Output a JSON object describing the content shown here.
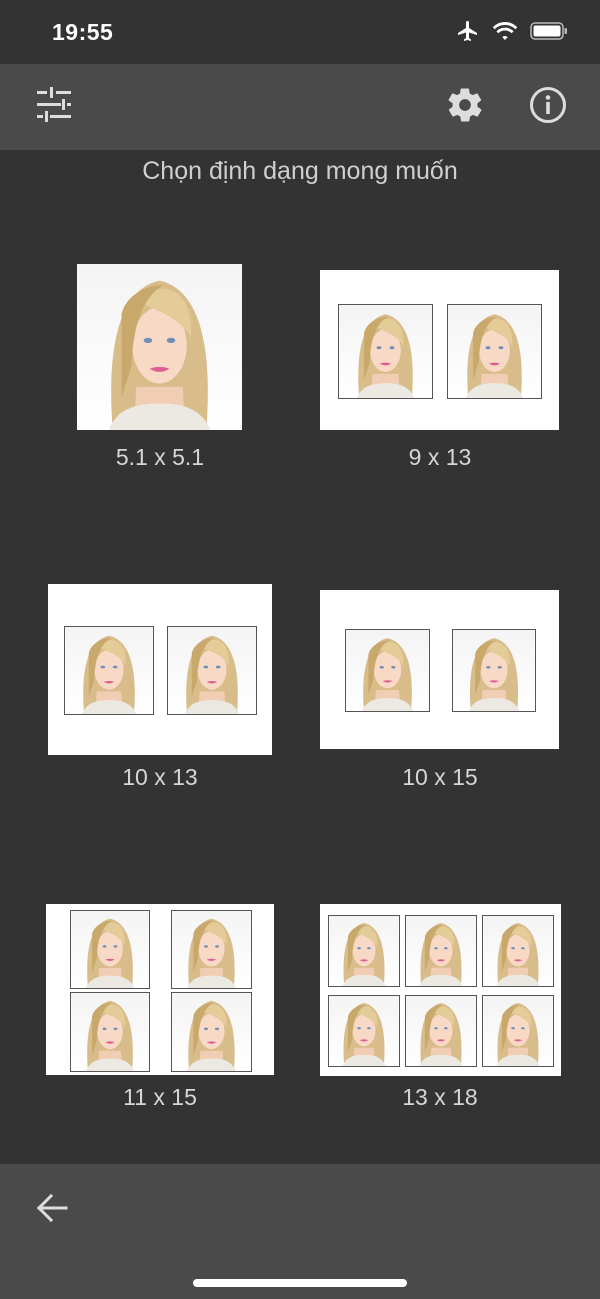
{
  "status_bar": {
    "time": "19:55"
  },
  "toolbar": {
    "icons": [
      "sliders-icon",
      "gear-icon",
      "info-icon"
    ]
  },
  "page": {
    "title": "Chọn định dạng mong muốn"
  },
  "formats": [
    {
      "label": "5.1 x 5.1"
    },
    {
      "label": "9 x 13"
    },
    {
      "label": "10 x 13"
    },
    {
      "label": "10 x 15"
    },
    {
      "label": "11 x 15"
    },
    {
      "label": "13 x 18"
    }
  ],
  "bottom_bar": {
    "icons": [
      "back-arrow-icon"
    ]
  },
  "colors": {
    "background": "#333333",
    "toolbar": "#4a4a4a",
    "icon": "#dddddd",
    "label": "#d6d6d6"
  }
}
